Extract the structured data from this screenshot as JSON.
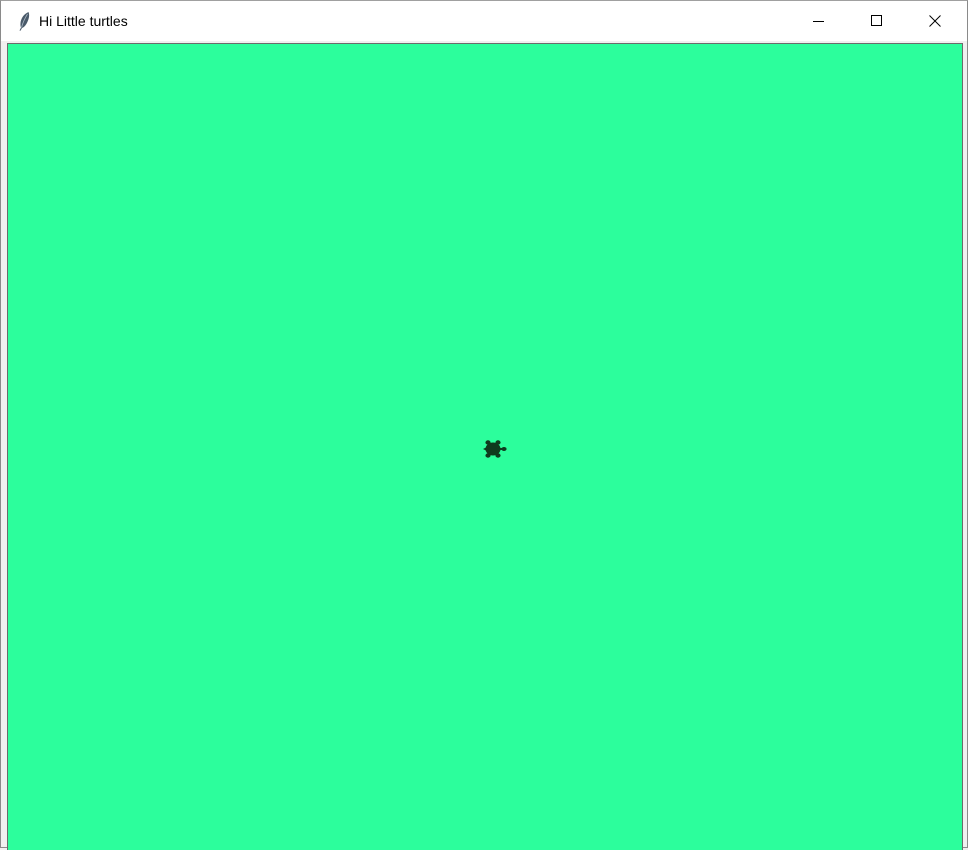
{
  "window": {
    "title": "Hi Little turtles",
    "app_icon": "feather-icon",
    "controls": {
      "minimize_icon": "minimize-icon",
      "maximize_icon": "maximize-icon",
      "close_icon": "close-icon"
    }
  },
  "canvas": {
    "background_color": "#2cfe9c",
    "turtle": {
      "icon": "turtle-icon",
      "color": "#0f3b1e",
      "heading": "east"
    }
  }
}
